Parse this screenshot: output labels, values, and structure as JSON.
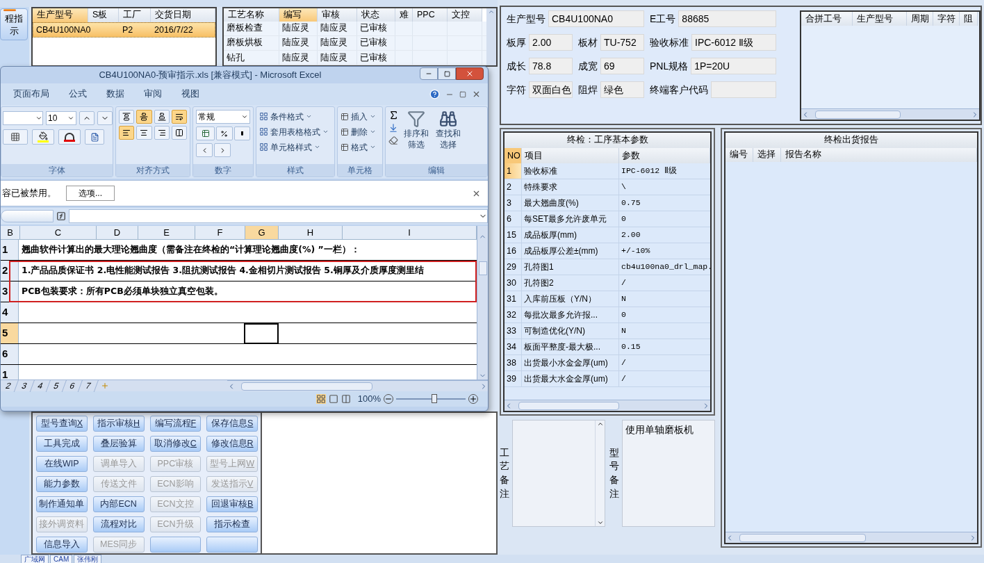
{
  "side_button": {
    "label": "程指示"
  },
  "order_grid": {
    "columns": [
      {
        "label": "生产型号",
        "selected": true
      },
      {
        "label": "S板",
        "selected": false
      },
      {
        "label": "工厂",
        "selected": false
      },
      {
        "label": "交货日期",
        "selected": false
      }
    ],
    "rows": [
      {
        "cells": [
          "CB4U100NA0",
          "",
          "P2",
          "2016/7/22"
        ],
        "selected": true
      }
    ]
  },
  "process_grid": {
    "columns": [
      {
        "label": "工艺名称",
        "selected": false
      },
      {
        "label": "编写",
        "selected": true
      },
      {
        "label": "审核",
        "selected": false
      },
      {
        "label": "状态",
        "selected": false
      },
      {
        "label": "难",
        "selected": false
      },
      {
        "label": "PPC",
        "selected": false
      },
      {
        "label": "文控",
        "selected": false
      }
    ],
    "rows": [
      {
        "cells": [
          "磨板检查",
          "陆应灵",
          "陆应灵",
          "已审核",
          "",
          "",
          ""
        ]
      },
      {
        "cells": [
          "磨板烘板",
          "陆应灵",
          "陆应灵",
          "已审核",
          "",
          "",
          ""
        ]
      },
      {
        "cells": [
          "钻孔",
          "陆应灵",
          "陆应灵",
          "已审核",
          "",
          "",
          ""
        ]
      }
    ]
  },
  "excel": {
    "title": "CB4U100NA0-预审指示.xls  [兼容模式] - Microsoft Excel",
    "ribbon_tabs": [
      "页面布局",
      "公式",
      "数据",
      "审阅",
      "视图"
    ],
    "font_size": "10",
    "align_buttons": [
      {
        "kind": "top",
        "on": false
      },
      {
        "kind": "middle",
        "on": true
      },
      {
        "kind": "bottom",
        "on": false
      },
      {
        "kind": "wrap",
        "on": true
      },
      {
        "kind": "left",
        "on": true
      },
      {
        "kind": "center",
        "on": false
      },
      {
        "kind": "right",
        "on": false
      },
      {
        "kind": "merge",
        "on": false
      }
    ],
    "number_format": "常规",
    "style_items": [
      "条件格式",
      "套用表格格式",
      "单元格样式"
    ],
    "cell_items": [
      "插入",
      "删除",
      "格式"
    ],
    "edit_items": [
      "排序和筛选",
      "查找和选择"
    ],
    "groups": [
      "字体",
      "对齐方式",
      "数字",
      "样式",
      "单元格",
      "编辑"
    ],
    "message": "容已被禁用。",
    "options_button": "选项...",
    "columns": [
      {
        "label": "B",
        "selected": false
      },
      {
        "label": "C",
        "selected": false
      },
      {
        "label": "D",
        "selected": false
      },
      {
        "label": "E",
        "selected": false
      },
      {
        "label": "F",
        "selected": false
      },
      {
        "label": "G",
        "selected": true
      },
      {
        "label": "H",
        "selected": false
      },
      {
        "label": "I",
        "selected": false
      }
    ],
    "row_groups": [
      {
        "highlighted": false,
        "rows": [
          {
            "header": "1",
            "text": "翘曲软件计算出的最大理论翘曲度（需备注在终检的“计算理论翘曲度(%) ”一栏）：",
            "selected": false
          }
        ]
      },
      {
        "highlighted": true,
        "rows": [
          {
            "header": "2",
            "text": "1.产品品质保证书 2.电性能测试报告  3.阻抗测试报告 4.金相切片测试报告 5.铜厚及介质厚度测里结",
            "selected": false
          },
          {
            "header": "3",
            "text": "PCB包装要求：所有PCB必须单块独立真空包装。",
            "selected": false
          }
        ]
      },
      {
        "highlighted": false,
        "rows": [
          {
            "header": "4",
            "selected": false
          },
          {
            "header": "5",
            "selected": true
          },
          {
            "header": "6",
            "selected": false
          },
          {
            "header": "1",
            "selected": false
          }
        ]
      }
    ],
    "sheet_tabs": [
      "2",
      "3",
      "4",
      "5",
      "6",
      "7"
    ],
    "zoom": {
      "label": "100%",
      "level": 0.55
    }
  },
  "buttons": [
    {
      "label": "型号查询",
      "key": "X",
      "disabled": false
    },
    {
      "label": "指示审核",
      "key": "H",
      "disabled": false
    },
    {
      "label": "编写流程",
      "key": "F",
      "disabled": false
    },
    {
      "label": "保存信息",
      "key": "S",
      "disabled": false
    },
    {
      "label": "工具完成",
      "disabled": false
    },
    {
      "label": "叠层验算",
      "disabled": false
    },
    {
      "label": "取消修改",
      "key": "C",
      "disabled": false
    },
    {
      "label": "修改信息",
      "key": "R",
      "disabled": false
    },
    {
      "label": "在线WIP",
      "disabled": false
    },
    {
      "label": "调单导入",
      "disabled": true
    },
    {
      "label": "PPC审核",
      "disabled": true
    },
    {
      "label": "型号上网",
      "key": "W",
      "disabled": true
    },
    {
      "label": "能力参数",
      "disabled": false
    },
    {
      "label": "传送文件",
      "disabled": true
    },
    {
      "label": "ECN影响",
      "disabled": true
    },
    {
      "label": "发送指示",
      "key": "V",
      "disabled": true
    },
    {
      "label": "制作通知单",
      "disabled": false
    },
    {
      "label": "内部ECN",
      "disabled": false
    },
    {
      "label": "ECN文控",
      "disabled": true
    },
    {
      "label": "回退审核",
      "key": "B",
      "disabled": false
    },
    {
      "label": "接外调资料",
      "disabled": true
    },
    {
      "label": "流程对比",
      "disabled": false
    },
    {
      "label": "ECN升级",
      "disabled": true
    },
    {
      "label": "指示检查",
      "disabled": false
    },
    {
      "label": "信息导入",
      "disabled": false
    },
    {
      "label": "MES同步",
      "disabled": true
    },
    {
      "disabled": false
    },
    {
      "disabled": false
    }
  ],
  "bottom_tabs": [
    "广域网",
    "CAM",
    "张伟刚"
  ],
  "info": {
    "fields": [
      {
        "label": "生产型号",
        "value": "CB4U100NA0"
      },
      {
        "label": "E工号",
        "value": "88685"
      },
      {
        "label": "板厚",
        "value": "2.00"
      },
      {
        "label": "板材",
        "value": "TU-752"
      },
      {
        "label": "验收标准",
        "value": "IPC-6012 Ⅱ级"
      },
      {
        "label": "成长",
        "value": "78.8"
      },
      {
        "label": "成宽",
        "value": "69"
      },
      {
        "label": "PNL规格",
        "value": "1P=20U"
      },
      {
        "label": "字符",
        "value": "双面白色"
      },
      {
        "label": "阻焊",
        "value": "绿色"
      },
      {
        "label": "终端客户代码"
      }
    ],
    "grid_columns": [
      "合拼工号",
      "生产型号",
      "周期",
      "字符",
      "阻"
    ]
  },
  "params": {
    "title": "终检：工序基本参数",
    "columns": [
      "NO",
      "项目",
      "参数"
    ],
    "rows": [
      {
        "no": "1",
        "item": "验收标准",
        "value": "IPC-6012 Ⅱ级",
        "selected": true
      },
      {
        "no": "2",
        "item": "特殊要求",
        "value": "\\",
        "selected": false
      },
      {
        "no": "3",
        "item": "最大翘曲度(%)",
        "value": "0.75",
        "selected": false
      },
      {
        "no": "6",
        "item": "每SET最多允许废单元",
        "value": "0",
        "selected": false
      },
      {
        "no": "15",
        "item": "成品板厚(mm)",
        "value": "2.00",
        "selected": false
      },
      {
        "no": "16",
        "item": "成品板厚公差±(mm)",
        "value": "+/-10%",
        "selected": false
      },
      {
        "no": "29",
        "item": "孔符图1",
        "value": "cb4u100na0_drl_map.",
        "selected": false
      },
      {
        "no": "30",
        "item": "孔符图2",
        "value": "/",
        "selected": false
      },
      {
        "no": "31",
        "item": "入库前压板（Y/N）",
        "value": "N",
        "selected": false
      },
      {
        "no": "32",
        "item": "每批次最多允许报...",
        "value": "0",
        "selected": false
      },
      {
        "no": "33",
        "item": "可制造优化(Y/N)",
        "value": "N",
        "selected": false
      },
      {
        "no": "34",
        "item": "板面平整度-最大极...",
        "value": "0.15",
        "selected": false
      },
      {
        "no": "38",
        "item": "出货最小水金金厚(um)",
        "value": "/",
        "selected": false
      },
      {
        "no": "39",
        "item": "出货最大水金金厚(um)",
        "value": "/",
        "selected": false
      }
    ]
  },
  "report": {
    "title": "终检出货报告",
    "columns": [
      "编号",
      "选择",
      "报告名称"
    ]
  },
  "remarks": [
    {
      "label": "工艺备注"
    },
    {
      "label": "型号备注",
      "value": "使用单轴磨板机"
    }
  ]
}
